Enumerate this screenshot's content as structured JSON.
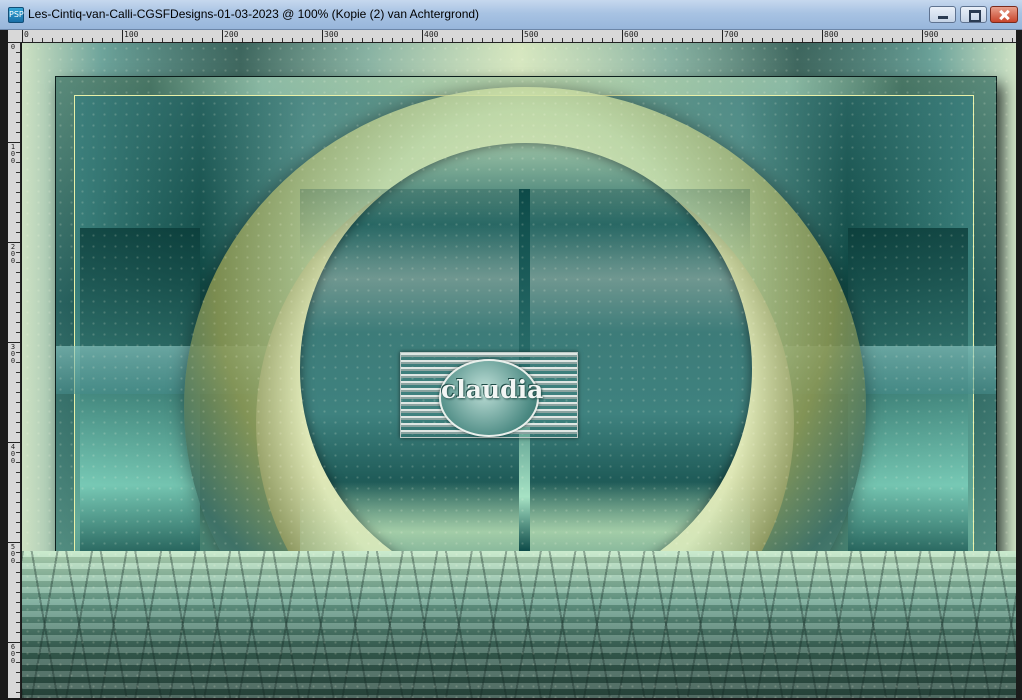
{
  "window": {
    "title": "Les-Cintiq-van-Calli-CGSFDesigns-01-03-2023 @ 100% (Kopie (2) van Achtergrond)",
    "app_icon": "psp-icon",
    "app_icon_text": "PSP"
  },
  "ruler": {
    "top_labels": [
      "0",
      "100",
      "200",
      "300",
      "400",
      "500",
      "600",
      "700",
      "800",
      "900"
    ],
    "left_labels": [
      "0",
      "100",
      "200",
      "300",
      "400",
      "500",
      "600"
    ]
  },
  "canvas": {
    "colors": {
      "teal_dark": "#0f4a45",
      "teal": "#3f827f",
      "sage": "#b9d6ad",
      "olive": "#8c9650",
      "mint": "#a6e2c4",
      "frame_line": "#e8f0a8"
    }
  },
  "watermark": {
    "text": "claudia",
    "sub": ""
  }
}
